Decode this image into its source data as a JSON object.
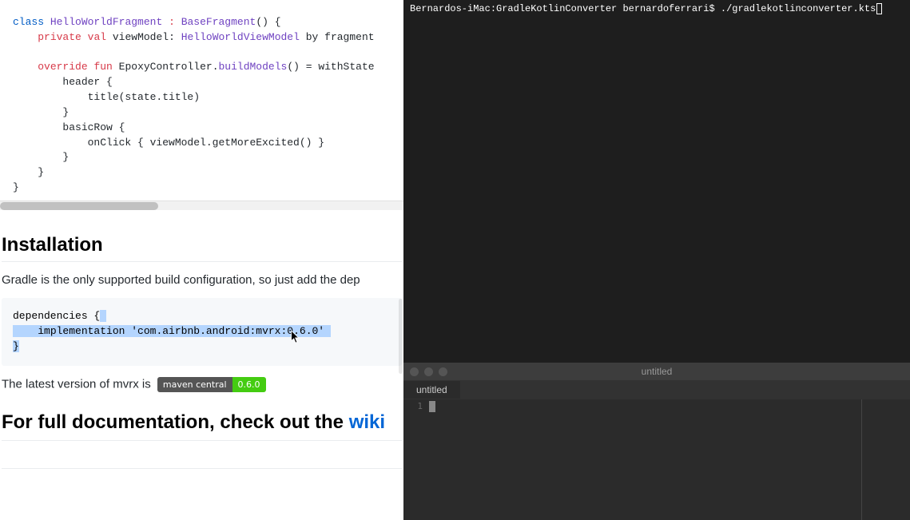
{
  "left": {
    "code_top": {
      "l1": {
        "kw": "class",
        "name": "HelloWorldFragment",
        "colon": ":",
        "base": "BaseFragment",
        "rest": "() {"
      },
      "l2": {
        "kw1": "private",
        "kw2": "val",
        "var": "viewModel:",
        "type": "HelloWorldViewModel",
        "rest": "by fragment"
      },
      "l3": {
        "kw1": "override",
        "kw2": "fun",
        "cls": "EpoxyController.",
        "method": "buildModels",
        "rest": "() = withState"
      },
      "l4": "        header {",
      "l5": "            title(state.title)",
      "l6": "        }",
      "l7": "        basicRow {",
      "l8": "            onClick { viewModel.getMoreExcited() }",
      "l9": "        }",
      "l10": "    }",
      "l11": "}"
    },
    "installation_heading": "Installation",
    "installation_text": "Gradle is the only supported build configuration, so just add the dep",
    "deps": {
      "l1": "dependencies {",
      "l2_indent": "    ",
      "l2_a": "implementation ",
      "l2_b": "'com.airbnb.android:mvrx:0",
      "l2_c": ".6.0'",
      "l3": "}"
    },
    "latest_text": "The latest version of mvrx is ",
    "badge": {
      "left": "maven central",
      "right": "0.6.0"
    },
    "doc_heading_prefix": "For full documentation, check out the ",
    "doc_link": "wiki"
  },
  "terminal": {
    "prompt": "Bernardos-iMac:GradleKotlinConverter bernardoferrari$ ./gradlekotlinconverter.kts"
  },
  "editor": {
    "window_title": "untitled",
    "tab_title": "untitled",
    "line_num": "1"
  }
}
